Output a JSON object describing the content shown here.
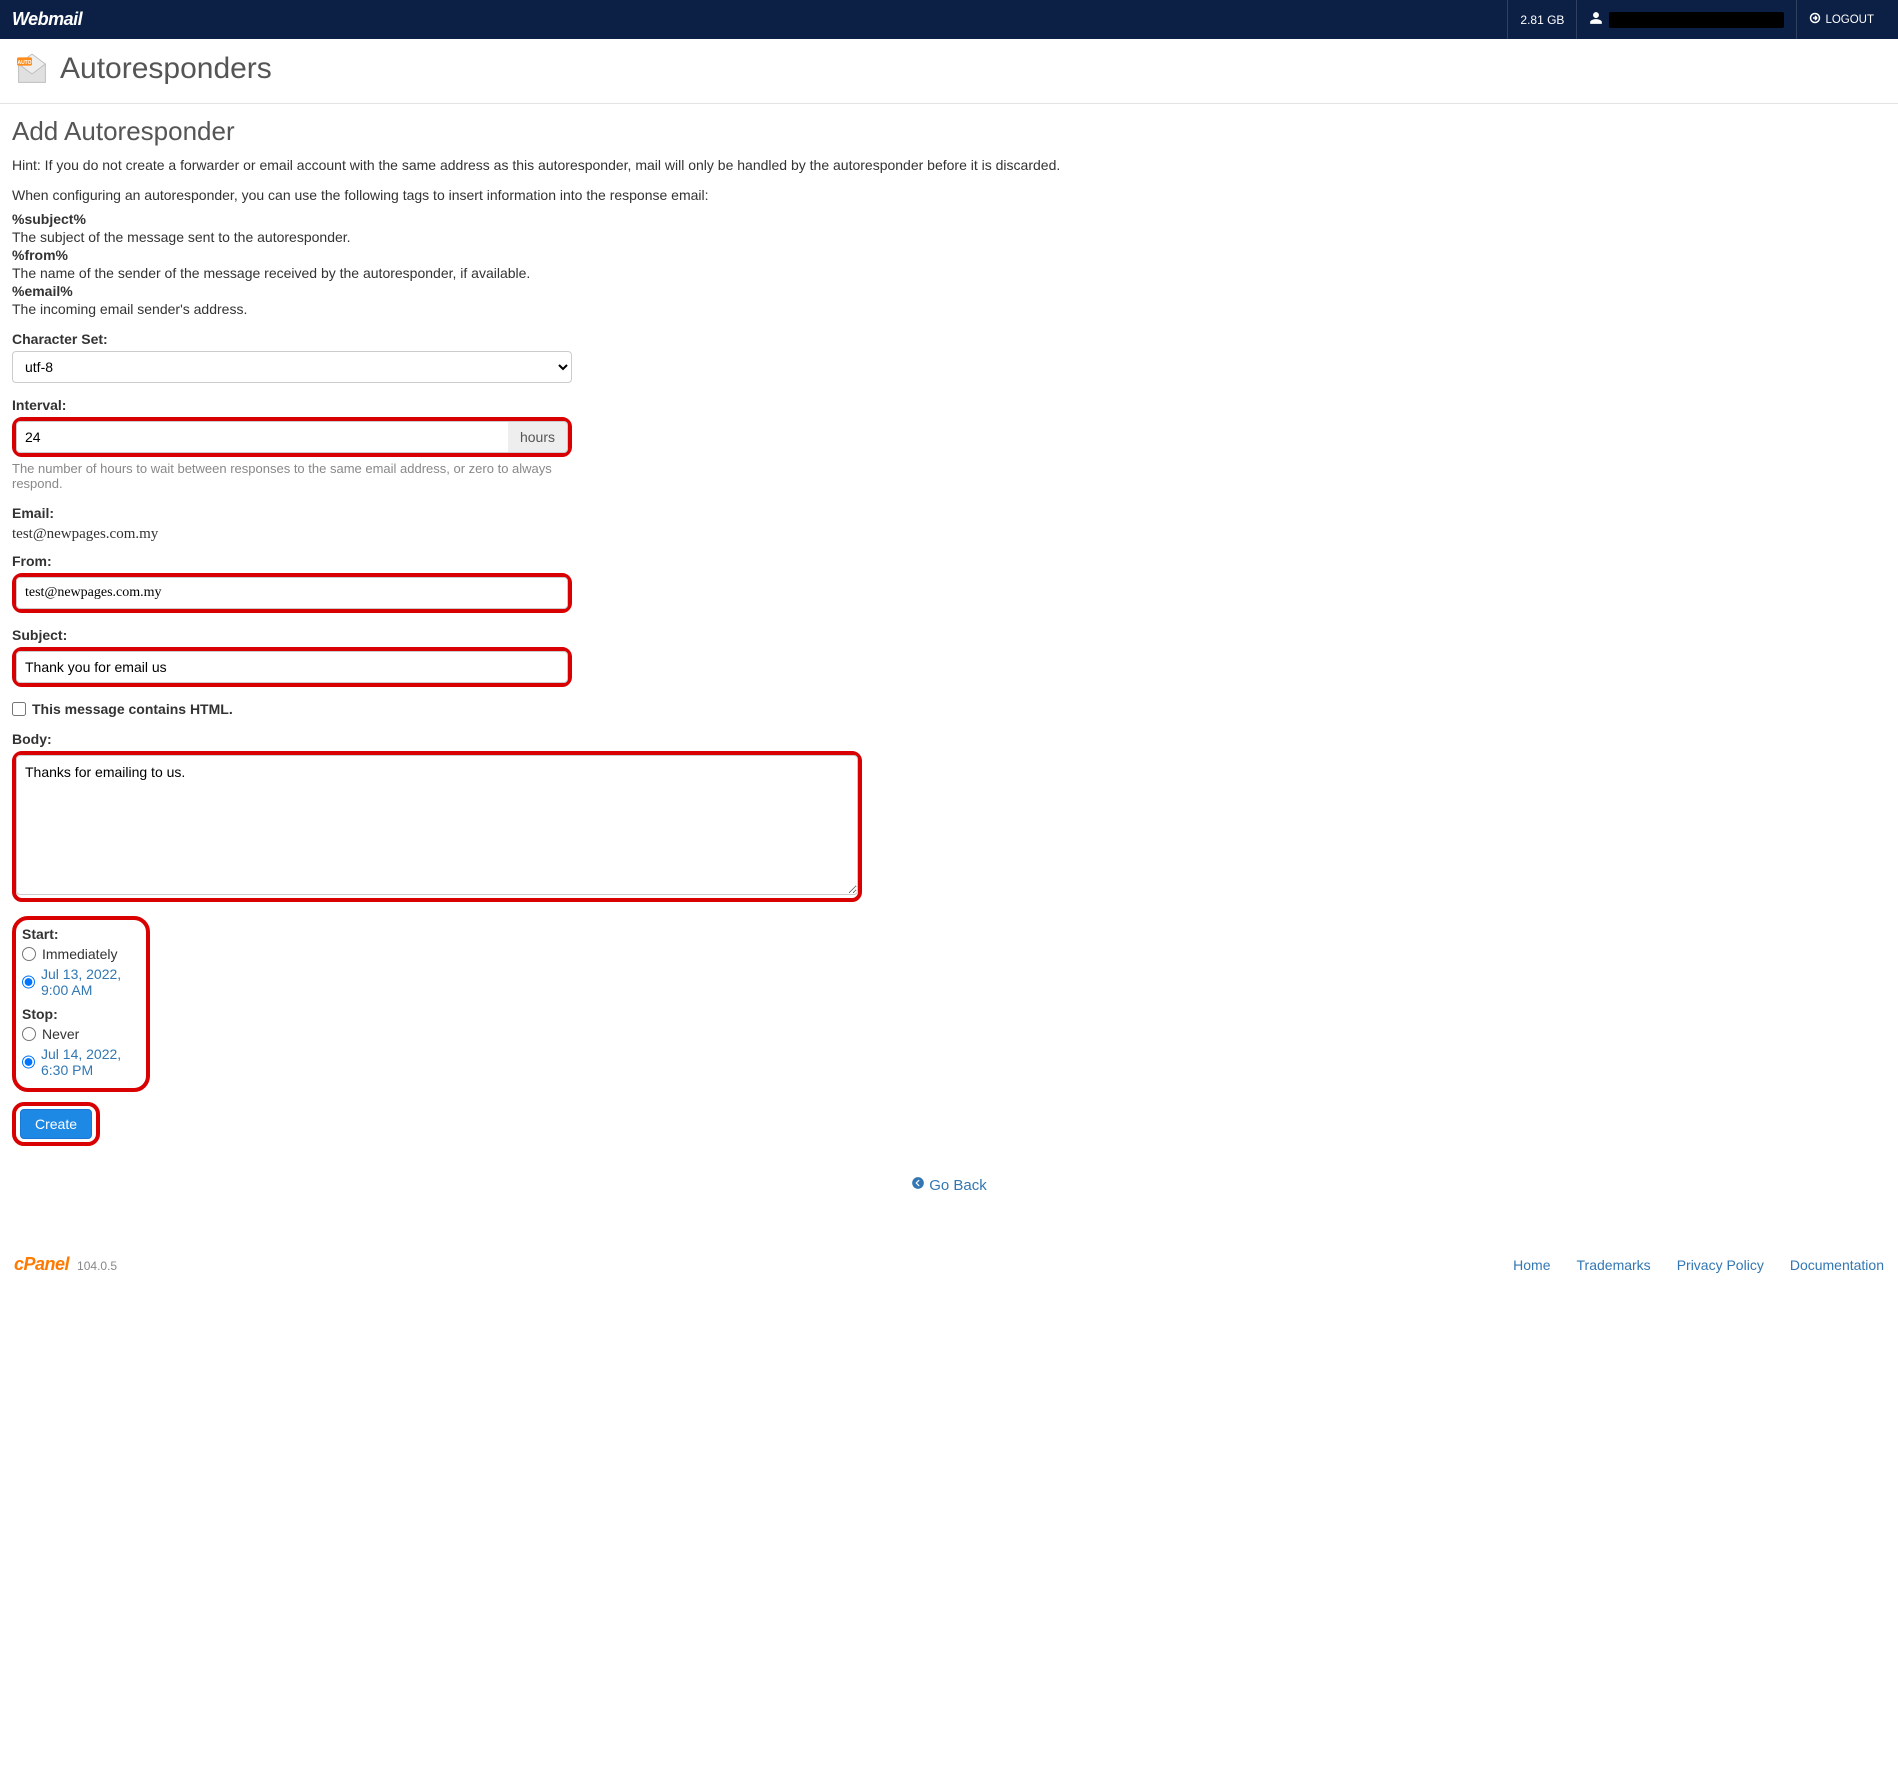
{
  "topbar": {
    "logo": "Webmail",
    "storage": "2.81 GB",
    "logout": "LOGOUT"
  },
  "header": {
    "title": "Autoresponders"
  },
  "section": {
    "title": "Add Autoresponder",
    "hint": "Hint: If you do not create a forwarder or email account with the same address as this autoresponder, mail will only be handled by the autoresponder before it is discarded.",
    "tags_intro": "When configuring an autoresponder, you can use the following tags to insert information into the response email:",
    "tags": [
      {
        "name": "%subject%",
        "desc": "The subject of the message sent to the autoresponder."
      },
      {
        "name": "%from%",
        "desc": "The name of the sender of the message received by the autoresponder, if available."
      },
      {
        "name": "%email%",
        "desc": "The incoming email sender's address."
      }
    ]
  },
  "form": {
    "charset_label": "Character Set:",
    "charset_value": "utf-8",
    "interval_label": "Interval:",
    "interval_value": "24",
    "interval_unit": "hours",
    "interval_help": "The number of hours to wait between responses to the same email address, or zero to always respond.",
    "email_label": "Email:",
    "email_value": "test@newpages.com.my",
    "from_label": "From:",
    "from_value": "test@newpages.com.my",
    "subject_label": "Subject:",
    "subject_value": "Thank you for email us",
    "html_label": "This message contains HTML.",
    "body_label": "Body:",
    "body_value": "Thanks for emailing to us.",
    "start_label": "Start:",
    "start_immediately": "Immediately",
    "start_custom": "Jul 13, 2022, 9:00 AM",
    "stop_label": "Stop:",
    "stop_never": "Never",
    "stop_custom": "Jul 14, 2022, 6:30 PM",
    "create_btn": "Create"
  },
  "go_back": "Go Back",
  "footer": {
    "brand": "cPanel",
    "version": "104.0.5",
    "links": {
      "home": "Home",
      "trademarks": "Trademarks",
      "privacy": "Privacy Policy",
      "docs": "Documentation"
    }
  }
}
